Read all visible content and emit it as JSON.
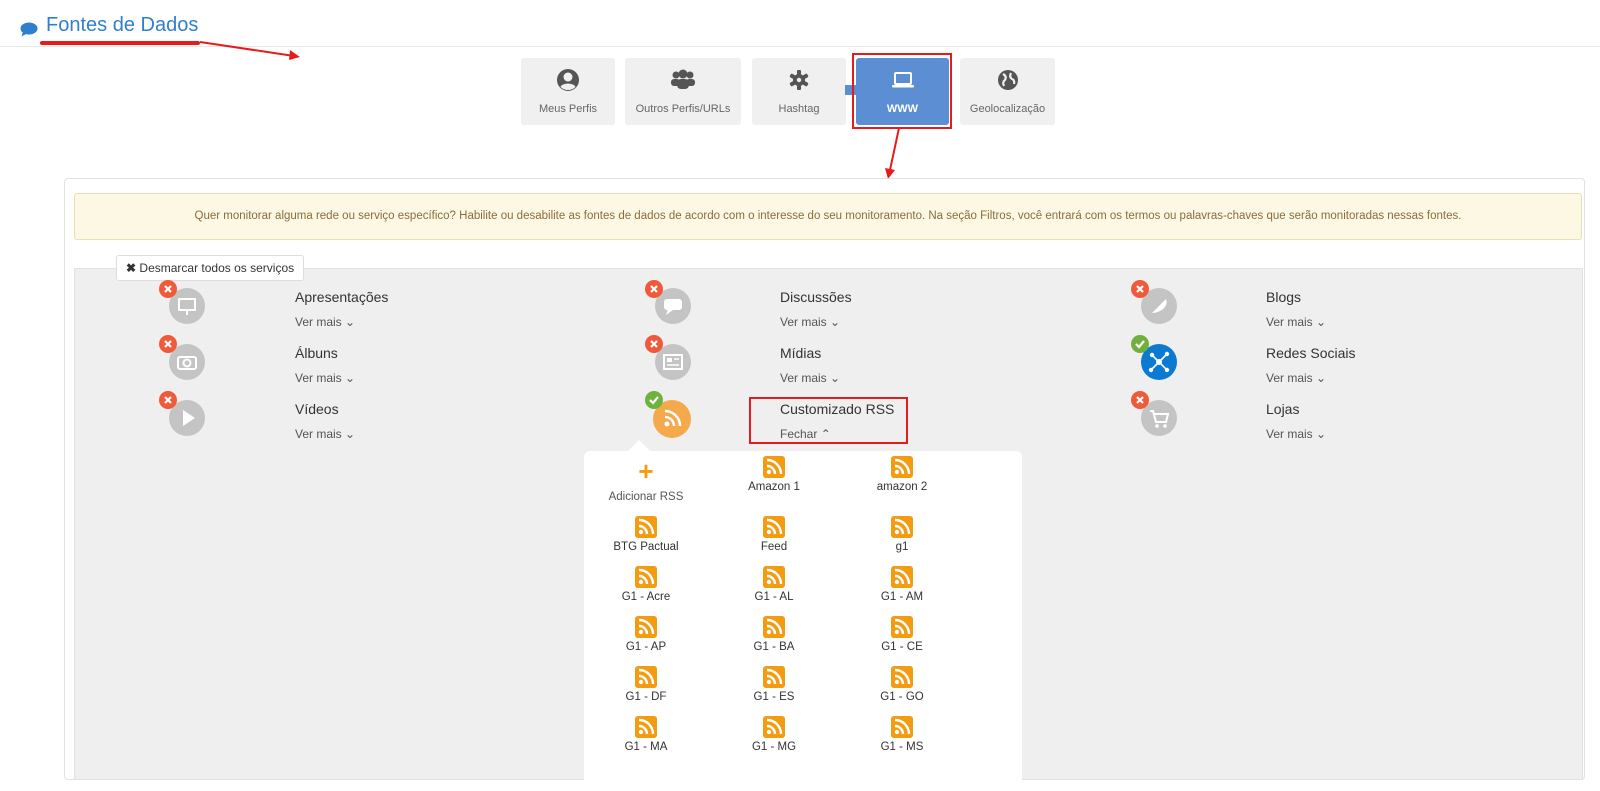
{
  "header": {
    "title": "Fontes de Dados",
    "icon": "comment-icon",
    "accent": "#2f7fcf"
  },
  "tabs": [
    {
      "label": "Meus Perfis",
      "icon": "user-circle-icon",
      "active": false
    },
    {
      "label": "Outros Perfis/URLs",
      "icon": "users-icon",
      "active": false
    },
    {
      "label": "Hashtag",
      "icon": "hashtag-icon",
      "active": false
    },
    {
      "label": "WWW",
      "icon": "laptop-icon",
      "active": true
    },
    {
      "label": "Geolocalização",
      "icon": "globe-icon",
      "active": false
    }
  ],
  "alert": {
    "text": "Quer monitorar alguma rede ou serviço específico? Habilite ou desabilite as fontes de dados de acordo com o interesse do seu monitoramento. Na seção Filtros, você entrará com os termos ou palavras-chaves que serão monitoradas nessas fontes."
  },
  "desmarcar": {
    "icon": "x-icon",
    "label": "Desmarcar todos os serviços"
  },
  "services": [
    {
      "title": "Apresentações",
      "more": "Ver mais",
      "enabled": false,
      "icon": "presentation-icon"
    },
    {
      "title": "Discussões",
      "more": "Ver mais",
      "enabled": false,
      "icon": "comments-icon"
    },
    {
      "title": "Blogs",
      "more": "Ver mais",
      "enabled": false,
      "icon": "feather-icon"
    },
    {
      "title": "Álbuns",
      "more": "Ver mais",
      "enabled": false,
      "icon": "camera-icon"
    },
    {
      "title": "Mídias",
      "more": "Ver mais",
      "enabled": false,
      "icon": "newspaper-icon"
    },
    {
      "title": "Redes Sociais",
      "more": "Ver mais",
      "enabled": true,
      "icon": "network-icon"
    },
    {
      "title": "Vídeos",
      "more": "Ver mais",
      "enabled": false,
      "icon": "play-icon"
    },
    {
      "title": "Customizado RSS",
      "more": "Fechar",
      "enabled": true,
      "icon": "rss-icon"
    },
    {
      "title": "Lojas",
      "more": "Ver mais",
      "enabled": false,
      "icon": "cart-icon"
    }
  ],
  "rss": {
    "add_label": "Adicionar RSS",
    "feeds": [
      "Amazon 1",
      "amazon 2",
      "BTG Pactual",
      "Feed",
      "g1",
      "G1 - Acre",
      "G1 - AL",
      "G1 - AM",
      "G1 - AP",
      "G1 - BA",
      "G1 - CE",
      "G1 - DF",
      "G1 - ES",
      "G1 - GO",
      "G1 - MA",
      "G1 - MG",
      "G1 - MS"
    ]
  },
  "colors": {
    "active_tab": "#5b8ed3",
    "disabled_badge": "#ef5b3a",
    "enabled_badge": "#6fb13c",
    "rss_orange": "#f39c12",
    "annotation_red": "#e61c1c"
  }
}
